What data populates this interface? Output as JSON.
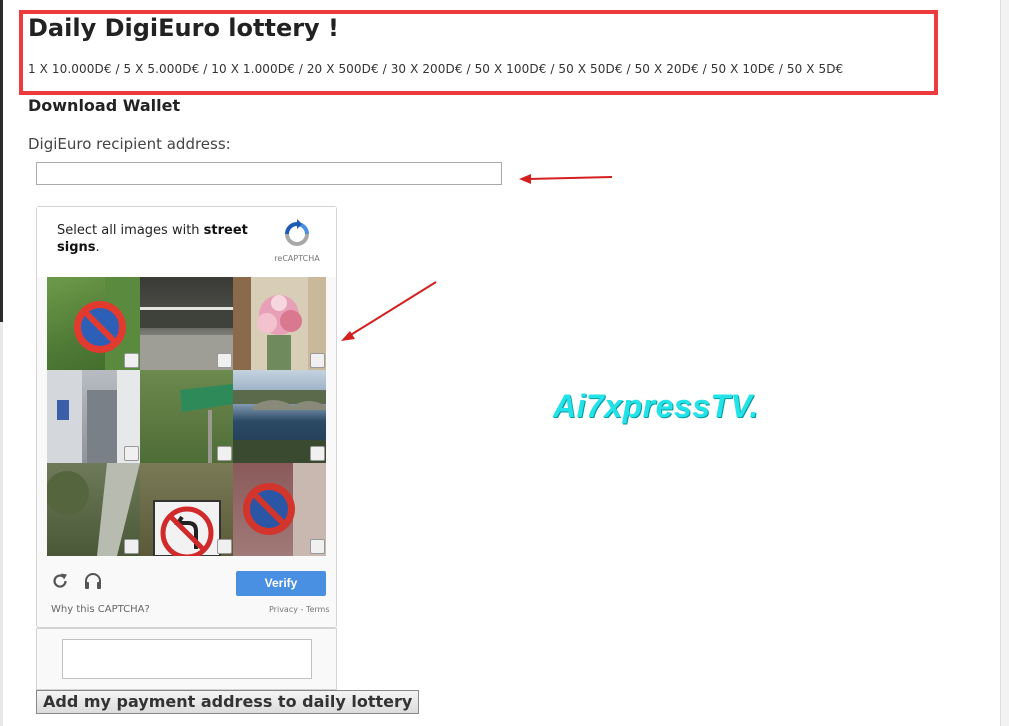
{
  "page": {
    "title": "Daily DigiEuro lottery !",
    "prizes": "1 X 10.000D€ / 5 X 5.000D€ / 10 X 1.000D€ / 20 X 500D€ / 30 X 200D€ / 50 X 100D€ / 50 X 50D€ / 50 X 20D€ / 50 X 10D€ / 50 X 5D€",
    "download_link": "Download Wallet",
    "address_label": "DigiEuro recipient address:",
    "address_value": "",
    "submit_label": "Add my payment address to daily lottery"
  },
  "captcha": {
    "prompt_prefix": "Select all images with ",
    "prompt_bold": "street signs",
    "prompt_suffix": ".",
    "brand": "reCAPTCHA",
    "verify_label": "Verify",
    "why_label": "Why this CAPTCHA?",
    "privacy_label": "Privacy",
    "separator": " - ",
    "terms_label": "Terms",
    "response_value": "",
    "tiles": [
      {
        "subject": "no-parking-sign",
        "selected": false
      },
      {
        "subject": "fence-road",
        "selected": false
      },
      {
        "subject": "flower-bouquet",
        "selected": false
      },
      {
        "subject": "building-storefront",
        "selected": false
      },
      {
        "subject": "green-street-sign",
        "selected": false
      },
      {
        "subject": "river-bridge",
        "selected": false
      },
      {
        "subject": "tree-pole",
        "selected": false
      },
      {
        "subject": "no-left-turn-sign",
        "selected": false
      },
      {
        "subject": "no-parking-sign-partial",
        "selected": false
      }
    ]
  },
  "watermark": "Ai7xpressTV.",
  "colors": {
    "header_border": "#ec3a3d",
    "annotation_arrow": "#d42020",
    "verify_button": "#4a90e2",
    "watermark": "#21e3e8"
  }
}
